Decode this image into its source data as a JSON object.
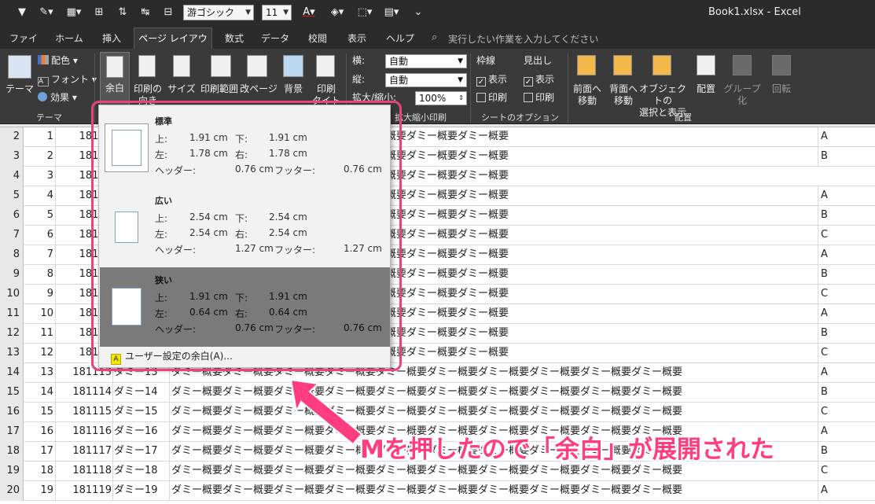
{
  "title_bar": {
    "font_name": "游ゴシック",
    "font_size": "11",
    "window_title": "Book1.xlsx  -  Excel"
  },
  "tabs": [
    {
      "label": "ファイル",
      "active": false
    },
    {
      "label": "ホーム",
      "active": false
    },
    {
      "label": "挿入",
      "active": false
    },
    {
      "label": "ページ レイアウト",
      "active": true
    },
    {
      "label": "数式",
      "active": false
    },
    {
      "label": "データ",
      "active": false
    },
    {
      "label": "校閲",
      "active": false
    },
    {
      "label": "表示",
      "active": false
    },
    {
      "label": "ヘルプ",
      "active": false
    }
  ],
  "tell_me": "実行したい作業を入力してください",
  "ribbon": {
    "theme": {
      "theme_btn": "テーマ",
      "colors": "配色",
      "fonts": "フォント",
      "effects": "効果",
      "group": "テーマ"
    },
    "page_setup": {
      "margins": "余白",
      "orientation": "印刷の\n向き",
      "size": "サイズ",
      "print_area": "印刷範囲",
      "breaks": "改ページ",
      "background": "背景",
      "titles": "印刷\nタイトル"
    },
    "scale": {
      "width_label": "横:",
      "width_value": "自動",
      "height_label": "縦:",
      "height_value": "自動",
      "scale_label": "拡大/縮小:",
      "scale_value": "100%",
      "group": "拡大縮小印刷"
    },
    "sheet_options": {
      "gridlines": "枠線",
      "headings": "見出し",
      "view": "表示",
      "print": "印刷",
      "group": "シートのオプション"
    },
    "arrange": {
      "bring_forward": "前面へ\n移動",
      "send_backward": "背面へ\n移動",
      "selection_pane": "オブジェクトの\n選択と表示",
      "align": "配置",
      "group_btn": "グループ化",
      "rotate": "回転",
      "group": "配置"
    }
  },
  "margins_dropdown": {
    "options": [
      {
        "name": "標準",
        "top_label": "上:",
        "top": "1.91 cm",
        "bottom_label": "下:",
        "bottom": "1.91 cm",
        "left_label": "左:",
        "left": "1.78 cm",
        "right_label": "右:",
        "right": "1.78 cm",
        "header_label": "ヘッダー:",
        "header": "0.76 cm",
        "footer_label": "フッター:",
        "footer": "0.76 cm",
        "selected": false
      },
      {
        "name": "広い",
        "top_label": "上:",
        "top": "2.54 cm",
        "bottom_label": "下:",
        "bottom": "2.54 cm",
        "left_label": "左:",
        "left": "2.54 cm",
        "right_label": "右:",
        "right": "2.54 cm",
        "header_label": "ヘッダー:",
        "header": "1.27 cm",
        "footer_label": "フッター:",
        "footer": "1.27 cm",
        "selected": false
      },
      {
        "name": "狭い",
        "top_label": "上:",
        "top": "1.91 cm",
        "bottom_label": "下:",
        "bottom": "1.91 cm",
        "left_label": "左:",
        "left": "0.64 cm",
        "right_label": "右:",
        "right": "0.64 cm",
        "header_label": "ヘッダー:",
        "header": "0.76 cm",
        "footer_label": "フッター:",
        "footer": "0.76 cm",
        "selected": true
      }
    ],
    "keytip": "A",
    "custom_label": "ユーザー設定の余白(A)..."
  },
  "grid": {
    "rows": [
      {
        "rh": "2",
        "a": "1",
        "b": "18110",
        "c": "",
        "d": "ー概要ダミー概要ダミー概要ダミー概要ダミー概要ダミー概要ダミー概要",
        "e": "A"
      },
      {
        "rh": "3",
        "a": "2",
        "b": "18110",
        "c": "",
        "d": "ー概要ダミー概要ダミー概要ダミー概要ダミー概要ダミー概要ダミー概要",
        "e": "B"
      },
      {
        "rh": "4",
        "a": "3",
        "b": "18110",
        "c": "",
        "d": "ー概要ダミー概要ダミー概要ダミー概要ダミー概要ダミー概要ダミー概要",
        "e": ""
      },
      {
        "rh": "5",
        "a": "4",
        "b": "18110",
        "c": "",
        "d": "ー概要ダミー概要ダミー概要ダミー概要ダミー概要ダミー概要ダミー概要",
        "e": "A"
      },
      {
        "rh": "6",
        "a": "5",
        "b": "18110",
        "c": "",
        "d": "ー概要ダミー概要ダミー概要ダミー概要ダミー概要ダミー概要ダミー概要",
        "e": "B"
      },
      {
        "rh": "7",
        "a": "6",
        "b": "18110",
        "c": "",
        "d": "ー概要ダミー概要ダミー概要ダミー概要ダミー概要ダミー概要ダミー概要",
        "e": "C"
      },
      {
        "rh": "8",
        "a": "7",
        "b": "18110",
        "c": "",
        "d": "ー概要ダミー概要ダミー概要ダミー概要ダミー概要ダミー概要ダミー概要",
        "e": "A"
      },
      {
        "rh": "9",
        "a": "8",
        "b": "18110",
        "c": "",
        "d": "ー概要ダミー概要ダミー概要ダミー概要ダミー概要ダミー概要ダミー概要",
        "e": "B"
      },
      {
        "rh": "10",
        "a": "9",
        "b": "18110",
        "c": "",
        "d": "ー概要ダミー概要ダミー概要ダミー概要ダミー概要ダミー概要ダミー概要",
        "e": "C"
      },
      {
        "rh": "11",
        "a": "10",
        "b": "18111",
        "c": "",
        "d": "ー概要ダミー概要ダミー概要ダミー概要ダミー概要ダミー概要ダミー概要",
        "e": "A"
      },
      {
        "rh": "12",
        "a": "11",
        "b": "18111",
        "c": "",
        "d": "ー概要ダミー概要ダミー概要ダミー概要ダミー概要ダミー概要ダミー概要",
        "e": "B"
      },
      {
        "rh": "13",
        "a": "12",
        "b": "18111",
        "c": "",
        "d": "ー概要ダミー概要ダミー概要ダミー概要ダミー概要ダミー概要ダミー概要",
        "e": "C"
      },
      {
        "rh": "14",
        "a": "13",
        "b": "181113",
        "c": "ダミー13",
        "d": "ダミー概要ダミー概要ダミー概要ダミー概要ダミー概要ダミー概要ダミー概要ダミー概要ダミー概要ダミー概要",
        "e": "A"
      },
      {
        "rh": "15",
        "a": "14",
        "b": "181114",
        "c": "ダミー14",
        "d": "ダミー概要ダミー概要ダミー概要ダミー概要ダミー概要ダミー概要ダミー概要ダミー概要ダミー概要ダミー概要",
        "e": "B"
      },
      {
        "rh": "16",
        "a": "15",
        "b": "181115",
        "c": "ダミー15",
        "d": "ダミー概要ダミー概要ダミー概要ダミー概要ダミー概要ダミー概要ダミー概要ダミー概要ダミー概要ダミー概要",
        "e": "C"
      },
      {
        "rh": "17",
        "a": "16",
        "b": "181116",
        "c": "ダミー16",
        "d": "ダミー概要ダミー概要ダミー概要ダミー概要ダミー概要ダミー概要ダミー概要ダミー概要ダミー概要ダミー概要",
        "e": "A"
      },
      {
        "rh": "18",
        "a": "17",
        "b": "181117",
        "c": "ダミー17",
        "d": "ダミー概要ダミー概要ダミー概要ダミー概要ダミー概要ダミー概要ダミー概要ダミー概要ダミー概要ダミー概要",
        "e": "B"
      },
      {
        "rh": "19",
        "a": "18",
        "b": "181118",
        "c": "ダミー18",
        "d": "ダミー概要ダミー概要ダミー概要ダミー概要ダミー概要ダミー概要ダミー概要ダミー概要ダミー概要ダミー概要",
        "e": "C"
      },
      {
        "rh": "20",
        "a": "19",
        "b": "181119",
        "c": "ダミー19",
        "d": "ダミー概要ダミー概要ダミー概要ダミー概要ダミー概要ダミー概要ダミー概要ダミー概要ダミー概要ダミー概要",
        "e": "A"
      }
    ]
  },
  "annotation": {
    "text": "Mを押したので「余白」が展開された",
    "color": "#ff3d7f"
  }
}
